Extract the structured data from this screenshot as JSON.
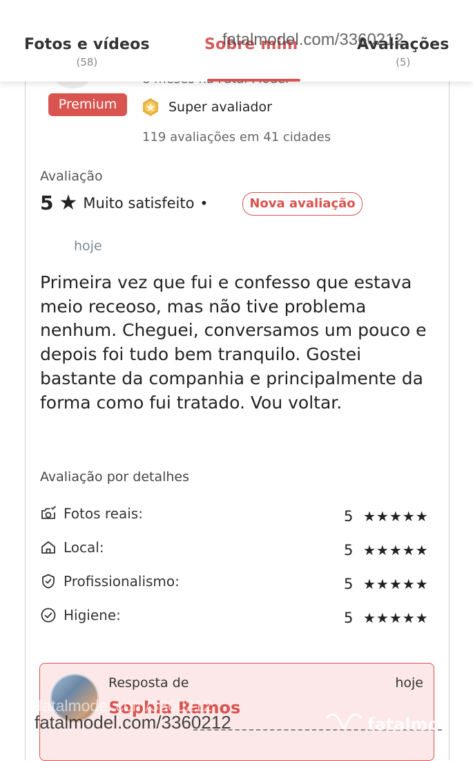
{
  "tabs": [
    {
      "label": "Fotos e vídeos",
      "count": "(58)"
    },
    {
      "label": "Sobre mim",
      "count": ""
    },
    {
      "label": "Avaliações",
      "count": "(5)"
    }
  ],
  "watermark": {
    "url": "fatalmodel.com/3360212",
    "logo_text": "fatalmo"
  },
  "reviewer": {
    "member_since": "8 meses na Fatal Model",
    "badge": "Premium",
    "super_label": "Super avaliador",
    "stats": "119 avaliações em 41 cidades"
  },
  "rating": {
    "section_label": "Avaliação",
    "score": "5",
    "star": "★",
    "text": "Muito satisfeito",
    "separator": "•",
    "tag": "Nova avaliação",
    "when": "hoje"
  },
  "review_text": "Primeira vez que fui e confesso que estava meio receoso, mas não tive problema nenhum. Cheguei, conversamos um pouco e depois foi tudo bem tranquilo. Gostei bastante da companhia e principalmente da forma como fui tratado. Vou voltar.",
  "details": {
    "title": "Avaliação por detalhes",
    "items": [
      {
        "label": "Fotos reais:",
        "score": "5",
        "stars": "★★★★★",
        "icon": "camera-icon"
      },
      {
        "label": "Local:",
        "score": "5",
        "stars": "★★★★★",
        "icon": "home-icon"
      },
      {
        "label": "Profissionalismo:",
        "score": "5",
        "stars": "★★★★★",
        "icon": "shield-check-icon"
      },
      {
        "label": "Higiene:",
        "score": "5",
        "stars": "★★★★★",
        "icon": "check-circle-icon"
      }
    ]
  },
  "response": {
    "label": "Resposta de",
    "time": "hoje",
    "name": "Sophia Ramos"
  },
  "colors": {
    "accent": "#d9534f",
    "response_bg": "#fce8e8",
    "badge_gold": "#e8b040"
  }
}
